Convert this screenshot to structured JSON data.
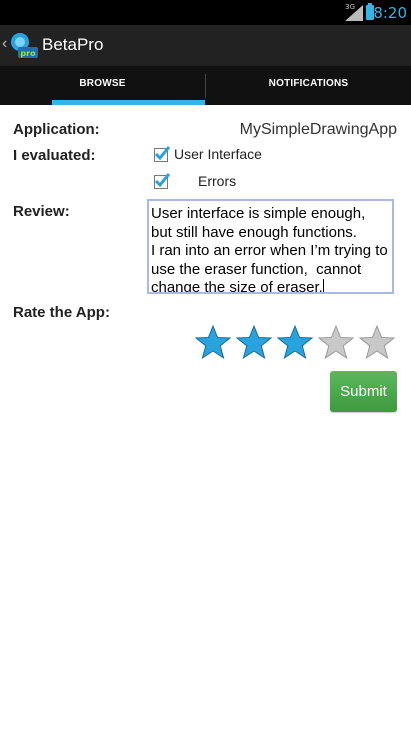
{
  "status_bar": {
    "network": "3G",
    "time": "8:20"
  },
  "action_bar": {
    "title": "BetaPro",
    "logo_text": "pro"
  },
  "tabs": [
    {
      "label": "BROWSE",
      "selected": true
    },
    {
      "label": "NOTIFICATIONS",
      "selected": false
    }
  ],
  "form": {
    "application_label": "Application:",
    "application_value": "MySimpleDrawingApp",
    "evaluated_label": "I evaluated:",
    "evaluated_options": [
      {
        "label": "User Interface",
        "checked": true
      },
      {
        "label": "Errors",
        "checked": true
      }
    ],
    "review_label": "Review:",
    "review_text": "User interface is simple enough, but still have enough functions.\nI ran into an error when I’m trying to use the eraser function,  cannot change the size of eraser.",
    "rate_label": "Rate the App:",
    "rating": 3,
    "rating_max": 5,
    "submit_label": "Submit"
  },
  "colors": {
    "accent": "#33b5e5",
    "star_filled": "#29a3dd",
    "star_empty": "#c8c8c8",
    "submit": "#4cae4c"
  }
}
